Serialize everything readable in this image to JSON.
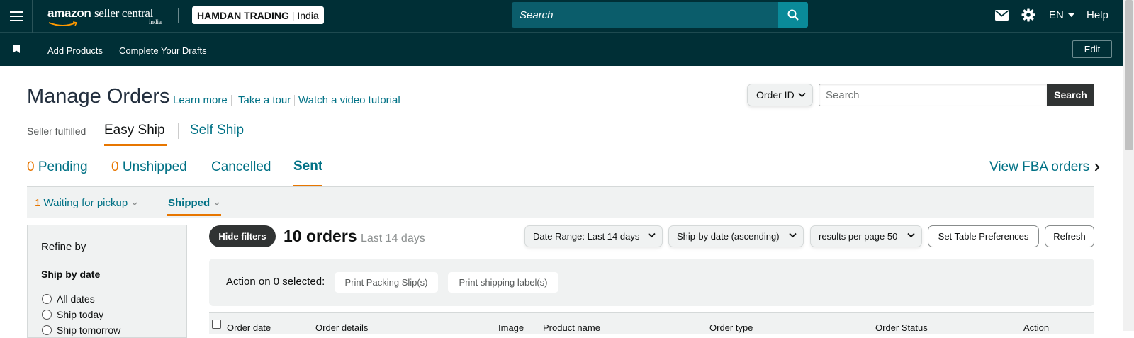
{
  "header": {
    "logo_main": "amazon",
    "logo_sub": "seller central",
    "logo_region": "india",
    "store_name": "HAMDAN TRADING",
    "store_region": "India",
    "search_placeholder": "Search",
    "language": "EN",
    "help": "Help"
  },
  "nav": {
    "items": [
      "Add Products",
      "Complete Your Drafts"
    ],
    "edit": "Edit"
  },
  "page": {
    "title": "Manage Orders",
    "links": [
      "Learn more",
      "Take a tour",
      "Watch a video tutorial"
    ],
    "search_type": "Order ID",
    "search_placeholder": "Search",
    "search_button": "Search"
  },
  "fulfilment": {
    "label": "Seller fulfilled",
    "active": "Easy Ship",
    "other": "Self Ship"
  },
  "tabs": {
    "pending_count": "0",
    "pending": "Pending",
    "unshipped_count": "0",
    "unshipped": "Unshipped",
    "cancelled": "Cancelled",
    "sent": "Sent",
    "fba": "View FBA orders"
  },
  "subtabs": {
    "waiting_count": "1",
    "waiting": "Waiting for pickup",
    "shipped": "Shipped"
  },
  "filters": {
    "title": "Refine by",
    "ship_by_date": "Ship by date",
    "options": [
      "All dates",
      "Ship today",
      "Ship tomorrow"
    ]
  },
  "toolbar": {
    "hide_filters": "Hide filters",
    "orders_count": "10 orders",
    "orders_range": "Last 14 days",
    "date_range": "Date Range: Last 14 days",
    "sort": "Ship-by date (ascending)",
    "per_page": "results per page 50",
    "table_prefs": "Set Table Preferences",
    "refresh": "Refresh"
  },
  "actions": {
    "label": "Action on 0 selected:",
    "packing_slip": "Print Packing Slip(s)",
    "shipping_label": "Print shipping label(s)"
  },
  "table": {
    "columns": [
      "Order date",
      "Order details",
      "Image",
      "Product name",
      "Order type",
      "Order Status",
      "Action"
    ]
  },
  "colors": {
    "header_bg": "#002f36",
    "link": "#007185",
    "accent": "#e77600"
  }
}
